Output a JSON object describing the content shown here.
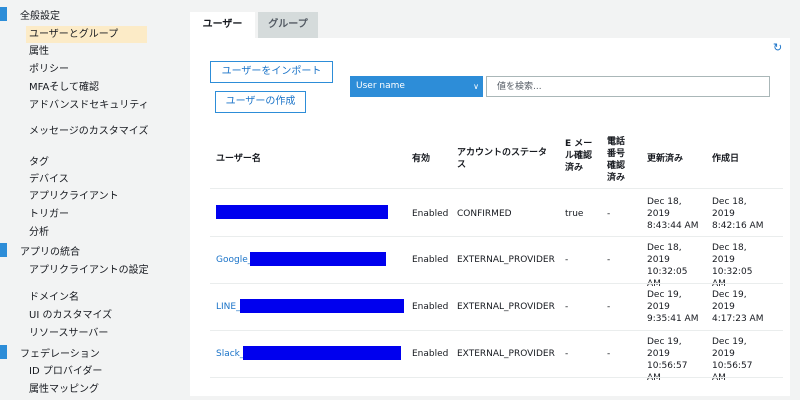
{
  "sidebar": {
    "sections": [
      {
        "label": "全般設定"
      },
      {
        "label": "アプリの統合"
      },
      {
        "label": "フェデレーション"
      }
    ],
    "general_items": [
      {
        "label": "ユーザーとグループ"
      },
      {
        "label": "属性"
      },
      {
        "label": "ポリシー"
      },
      {
        "label": "MFAそして確認"
      },
      {
        "label": "アドバンスドセキュリティ"
      },
      {
        "label": "メッセージのカスタマイズ"
      },
      {
        "label": "タグ"
      },
      {
        "label": "デバイス"
      },
      {
        "label": "アプリクライアント"
      },
      {
        "label": "トリガー"
      },
      {
        "label": "分析"
      }
    ],
    "app_items": [
      {
        "label": "アプリクライアントの設定"
      },
      {
        "label": "ドメイン名"
      },
      {
        "label": "UI のカスタマイズ"
      },
      {
        "label": "リソースサーバー"
      }
    ],
    "federation_items": [
      {
        "label": "ID プロバイダー"
      },
      {
        "label": "属性マッピング"
      }
    ]
  },
  "tabs": {
    "users": "ユーザー",
    "groups": "グループ"
  },
  "actions": {
    "import_label": "ユーザーをインポート",
    "create_label": "ユーザーの作成"
  },
  "filter": {
    "selected": "User name",
    "search_placeholder": "値を検索..."
  },
  "table": {
    "headers": {
      "username": "ユーザー名",
      "enabled": "有効",
      "status": "アカウントのステータス",
      "email_verified": "E メール確認済み",
      "phone_verified": "電話番号確認済み",
      "updated": "更新済み",
      "created": "作成日"
    },
    "rows": [
      {
        "prefix": "",
        "enabled": "Enabled",
        "status": "CONFIRMED",
        "email": "true",
        "phone": "-",
        "updated": "Dec 18, 2019 8:43:44 AM",
        "created": "Dec 18, 2019 8:42:16 AM"
      },
      {
        "prefix": "Google_",
        "enabled": "Enabled",
        "status": "EXTERNAL_PROVIDER",
        "email": "-",
        "phone": "-",
        "updated": "Dec 18, 2019 10:32:05 AM",
        "created": "Dec 18, 2019 10:32:05 AM"
      },
      {
        "prefix": "LINE_",
        "enabled": "Enabled",
        "status": "EXTERNAL_PROVIDER",
        "email": "-",
        "phone": "-",
        "updated": "Dec 19, 2019 9:35:41 AM",
        "created": "Dec 19, 2019 4:17:23 AM"
      },
      {
        "prefix": "Slack_",
        "enabled": "Enabled",
        "status": "EXTERNAL_PROVIDER",
        "email": "-",
        "phone": "-",
        "updated": "Dec 19, 2019 10:56:57 AM",
        "created": "Dec 19, 2019 10:56:57 AM"
      }
    ]
  },
  "colors": {
    "accent": "#2d8dd8",
    "active_item_bg": "#fcebc7",
    "redaction": "#0000ee"
  },
  "icons": {
    "refresh": "refresh-icon",
    "dropdown": "chevron-down-icon"
  }
}
